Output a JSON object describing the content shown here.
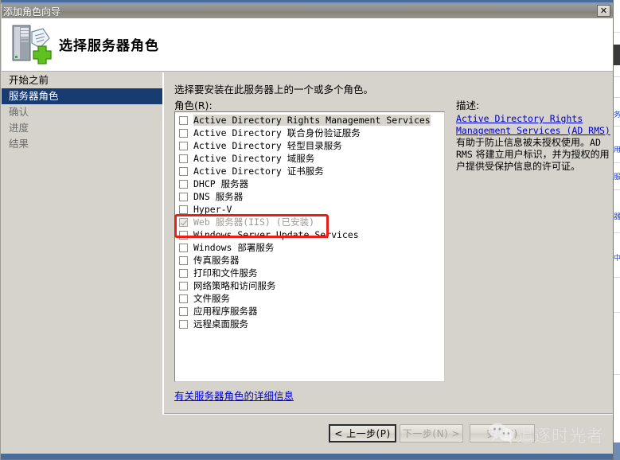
{
  "window": {
    "title": "添加角色向导",
    "close_label": "✕"
  },
  "header": {
    "title": "选择服务器角色",
    "icon": "server-add-icon"
  },
  "sidebar": {
    "items": [
      {
        "label": "开始之前",
        "selected": false,
        "dim": false
      },
      {
        "label": "服务器角色",
        "selected": true,
        "dim": false
      },
      {
        "label": "确认",
        "selected": false,
        "dim": true
      },
      {
        "label": "进度",
        "selected": false,
        "dim": true
      },
      {
        "label": "结果",
        "selected": false,
        "dim": true
      }
    ]
  },
  "main": {
    "prompt": "选择要安装在此服务器上的一个或多个角色。",
    "roles_label": "角色(R):",
    "more_info_link": "有关服务器角色的详细信息",
    "roles": [
      {
        "label": "Active Directory Rights Management Services",
        "checked": false,
        "installed": false,
        "highlight": true
      },
      {
        "label": "Active Directory 联合身份验证服务",
        "checked": false,
        "installed": false,
        "highlight": false
      },
      {
        "label": "Active Directory 轻型目录服务",
        "checked": false,
        "installed": false,
        "highlight": false
      },
      {
        "label": "Active Directory 域服务",
        "checked": false,
        "installed": false,
        "highlight": false
      },
      {
        "label": "Active Directory 证书服务",
        "checked": false,
        "installed": false,
        "highlight": false
      },
      {
        "label": "DHCP 服务器",
        "checked": false,
        "installed": false,
        "highlight": false
      },
      {
        "label": "DNS 服务器",
        "checked": false,
        "installed": false,
        "highlight": false
      },
      {
        "label": "Hyper-V",
        "checked": false,
        "installed": false,
        "highlight": false
      },
      {
        "label": "Web 服务器(IIS)  (已安装)",
        "checked": true,
        "installed": true,
        "highlight": false
      },
      {
        "label": "Windows Server Update Services",
        "checked": false,
        "installed": false,
        "highlight": false
      },
      {
        "label": "Windows 部署服务",
        "checked": false,
        "installed": false,
        "highlight": false
      },
      {
        "label": "传真服务器",
        "checked": false,
        "installed": false,
        "highlight": false
      },
      {
        "label": "打印和文件服务",
        "checked": false,
        "installed": false,
        "highlight": false
      },
      {
        "label": "网络策略和访问服务",
        "checked": false,
        "installed": false,
        "highlight": false
      },
      {
        "label": "文件服务",
        "checked": false,
        "installed": false,
        "highlight": false
      },
      {
        "label": "应用程序服务器",
        "checked": false,
        "installed": false,
        "highlight": false
      },
      {
        "label": "远程桌面服务",
        "checked": false,
        "installed": false,
        "highlight": false
      }
    ]
  },
  "description": {
    "title": "描述:",
    "link_text": "Active Directory Rights Management Services (AD RMS)",
    "body_part1": "有助于防止信息被未授权使用。",
    "body_mono": "AD RMS",
    "body_part2": " 将建立用户标识，并为授权的用户提供受保护信息的许可证。"
  },
  "footer": {
    "prev_label": "< 上一步(P)",
    "next_label": "下一步(N) >",
    "install_label": "安装(I)"
  },
  "annotation": {
    "shape": "red-rectangle",
    "target_role": "Web 服务器(IIS)  (已安装)",
    "color": "#ee1c17"
  },
  "watermark": {
    "text": "追逐时光者",
    "icon": "wechat-icon"
  },
  "colors": {
    "titlebar": "#8d8d86",
    "accent_blue": "#4a6c9b",
    "selection_blue": "#183b72",
    "dialog_bg": "#d6d3cc",
    "link_blue": "#0000d0",
    "annotation_red": "#ee1c17"
  }
}
